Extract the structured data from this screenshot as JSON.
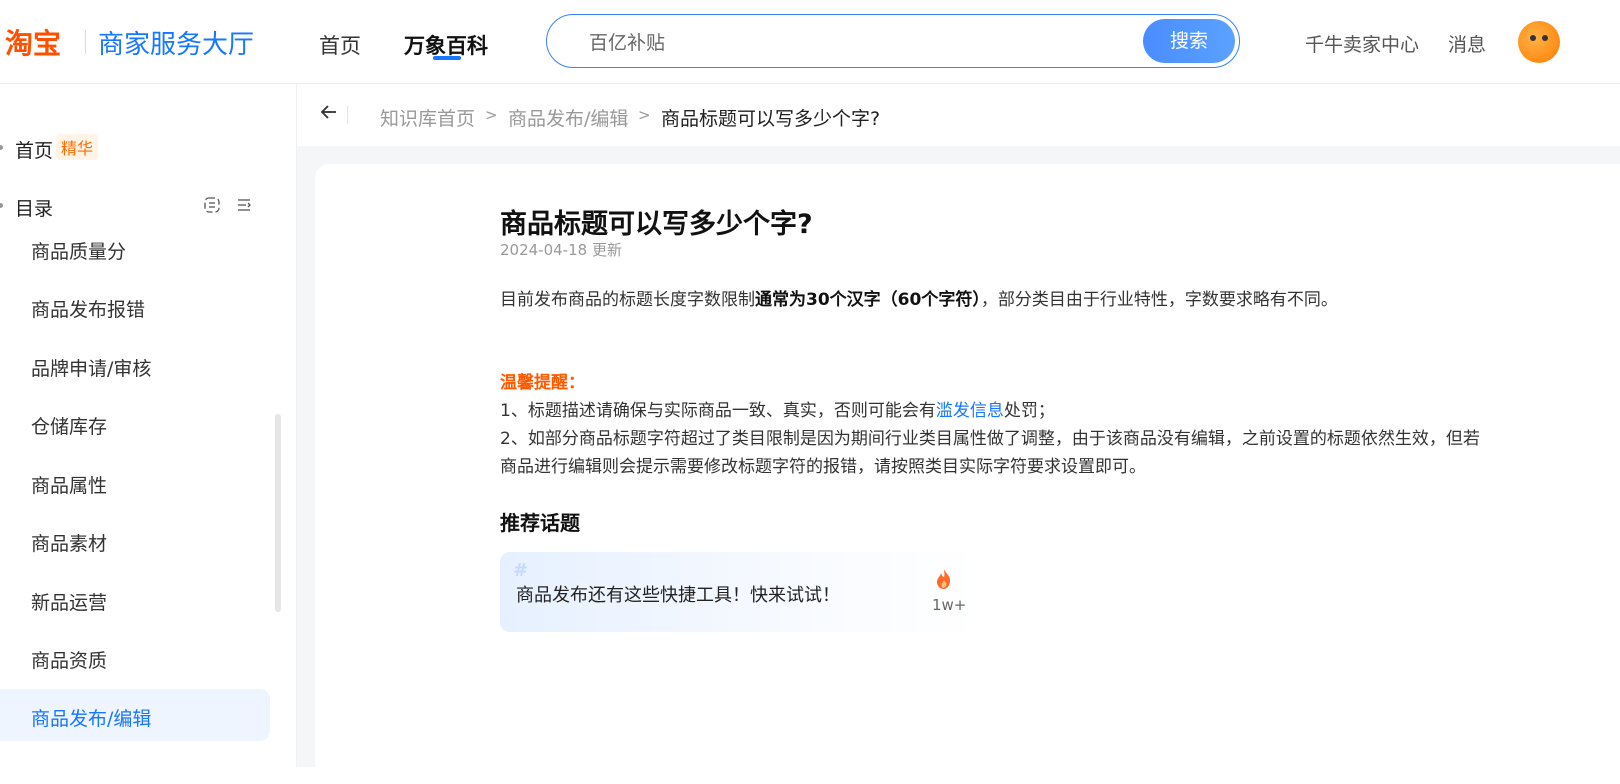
{
  "header": {
    "logo": "淘宝",
    "logo_sub": "商家服务大厅",
    "nav": [
      {
        "label": "首页"
      },
      {
        "label": "万象百科"
      }
    ],
    "search": {
      "value": "百亿补贴",
      "button": "搜索"
    },
    "links": [
      "千牛卖家中心",
      "消息"
    ]
  },
  "sidebar": {
    "home": "首页",
    "home_badge": "精华",
    "catalog": "目录",
    "items": [
      "商品质量分",
      "商品发布报错",
      "品牌申请/审核",
      "仓储库存",
      "商品属性",
      "商品素材",
      "新品运营",
      "商品资质",
      "商品发布/编辑"
    ],
    "active_index": 8
  },
  "breadcrumb": [
    "知识库首页",
    "商品发布/编辑",
    "商品标题可以写多少个字?"
  ],
  "article": {
    "title": "商品标题可以写多少个字?",
    "date": "2024-04-18 更新",
    "p1_pre": "目前发布商品的标题长度字数限制",
    "p1_bold": "通常为30个汉字（60个字符）",
    "p1_post": "，部分类目由于行业特性，字数要求略有不同。",
    "tip_title": "温馨提醒：",
    "tip1_pre": "1、标题描述请确保与实际商品一致、真实，否则可能会有",
    "tip1_link": "滥发信息",
    "tip1_post": "处罚；",
    "tip2_line1": "2、如部分商品标题字符超过了类目限制是因为期间行业类目属性做了调整，由于该商品没有编辑，之前设置的标题依然生效，但若",
    "tip2_line2": "商品进行编辑则会提示需要修改标题字符的报错，请按照类目实际字符要求设置即可。",
    "rec_title": "推荐话题",
    "topic": {
      "hash": "#",
      "text": "商品发布还有这些快捷工具！快来试试！",
      "count": "1w+"
    }
  },
  "colors": {
    "brand": "#ff5000",
    "accent": "#1677ff",
    "tip": "#ff5a00"
  }
}
